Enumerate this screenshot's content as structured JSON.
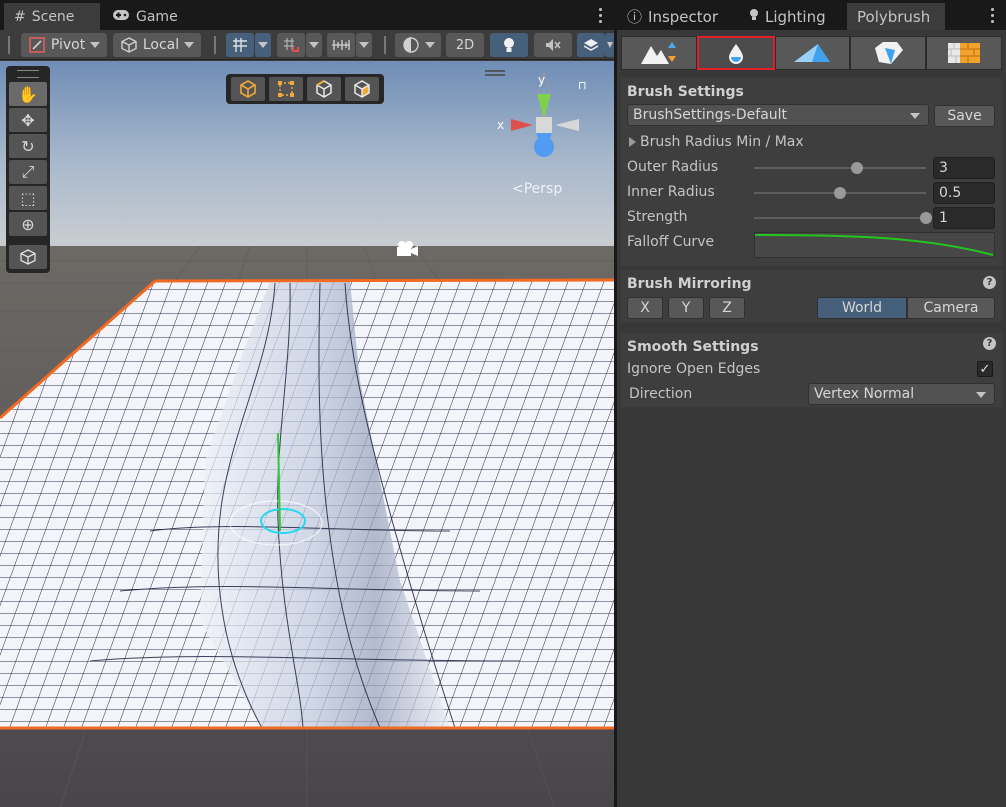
{
  "scene_tabs": [
    {
      "label": "Scene",
      "icon": "grid-icon"
    },
    {
      "label": "Game",
      "icon": "gamepad-icon"
    }
  ],
  "toolbar": {
    "pivot_label": "Pivot",
    "local_label": "Local",
    "mode_2d_label": "2D"
  },
  "viewport": {
    "persp_label": "<Persp",
    "gizmo_axes": {
      "x": "x",
      "y": "y"
    }
  },
  "side_tabs": [
    {
      "label": "Inspector",
      "icon": "inspector-icon"
    },
    {
      "label": "Lighting",
      "icon": "bulb-icon"
    },
    {
      "label": "Polybrush"
    }
  ],
  "polybrush_modes": [
    {
      "name": "sculpt-mode",
      "selected": false
    },
    {
      "name": "smooth-mode",
      "selected": true
    },
    {
      "name": "paint-color-mode",
      "selected": false
    },
    {
      "name": "prefab-mode",
      "selected": false
    },
    {
      "name": "texture-mode",
      "selected": false
    }
  ],
  "brush_settings": {
    "title": "Brush Settings",
    "preset": "BrushSettings-Default",
    "save_label": "Save",
    "radius_foldout": "Brush Radius Min / Max",
    "outer_radius": {
      "label": "Outer Radius",
      "value": "3",
      "fraction": 0.6
    },
    "inner_radius": {
      "label": "Inner Radius",
      "value": "0.5",
      "fraction": 0.5
    },
    "strength": {
      "label": "Strength",
      "value": "1",
      "fraction": 1.0
    },
    "falloff_label": "Falloff Curve"
  },
  "brush_mirroring": {
    "title": "Brush Mirroring",
    "axes": [
      "X",
      "Y",
      "Z"
    ],
    "space_world": "World",
    "space_camera": "Camera",
    "selected_space": "World"
  },
  "smooth_settings": {
    "title": "Smooth Settings",
    "ignore_open_edges_label": "Ignore Open Edges",
    "ignore_open_edges": true,
    "direction_label": "Direction",
    "direction_value": "Vertex Normal"
  },
  "colors": {
    "selection_outline": "#f26a21",
    "active_blue": "#46607c",
    "mode_highlight": "#e0202a",
    "curve_green": "#22c41e"
  }
}
